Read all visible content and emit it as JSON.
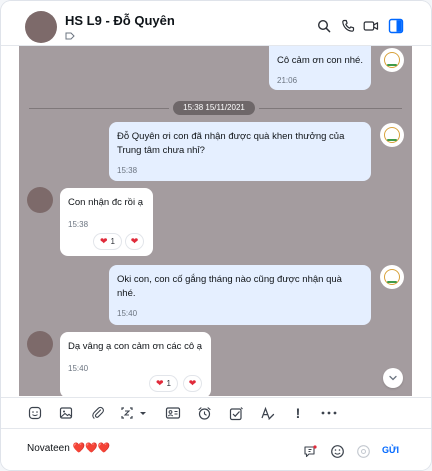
{
  "header": {
    "title": "HS L9 - Đỗ Quyên",
    "icons": [
      "search-icon",
      "phone-icon",
      "video-icon",
      "panel-toggle-icon"
    ],
    "accent": "#0068ff"
  },
  "chat": {
    "background": "#a49c9f",
    "date_divider": "15:38 15/11/2021",
    "messages": [
      {
        "side": "out",
        "text": "Cô cảm ơn con nhé.",
        "time": "21:06"
      },
      {
        "side": "out",
        "text": "Đỗ Quyên ơi con đã nhận được quà khen thưởng của Trung tâm chưa nhỉ?",
        "time": "15:38"
      },
      {
        "side": "in",
        "text": "Con nhận đc rồi ạ",
        "time": "15:38",
        "reaction_count": "1"
      },
      {
        "side": "out",
        "text": "Oki con, con cố gắng tháng nào cũng được nhận quà nhé.",
        "time": "15:40"
      },
      {
        "side": "in",
        "text": "Dạ vâng ạ con cảm ơn các cô ạ",
        "time": "15:40",
        "reaction_count": "1"
      }
    ]
  },
  "toolbar": {
    "icons": [
      "sticker-icon",
      "image-icon",
      "attachment-icon",
      "screenshot-icon",
      "contact-card-icon",
      "reminder-icon",
      "task-icon",
      "text-format-icon",
      "priority-icon",
      "more-icon"
    ]
  },
  "composer": {
    "value": "Novateen ❤️❤️❤️",
    "send_label": "GỬI",
    "icons": [
      "quick-message-icon",
      "emoji-icon",
      "at-mention-icon"
    ]
  }
}
